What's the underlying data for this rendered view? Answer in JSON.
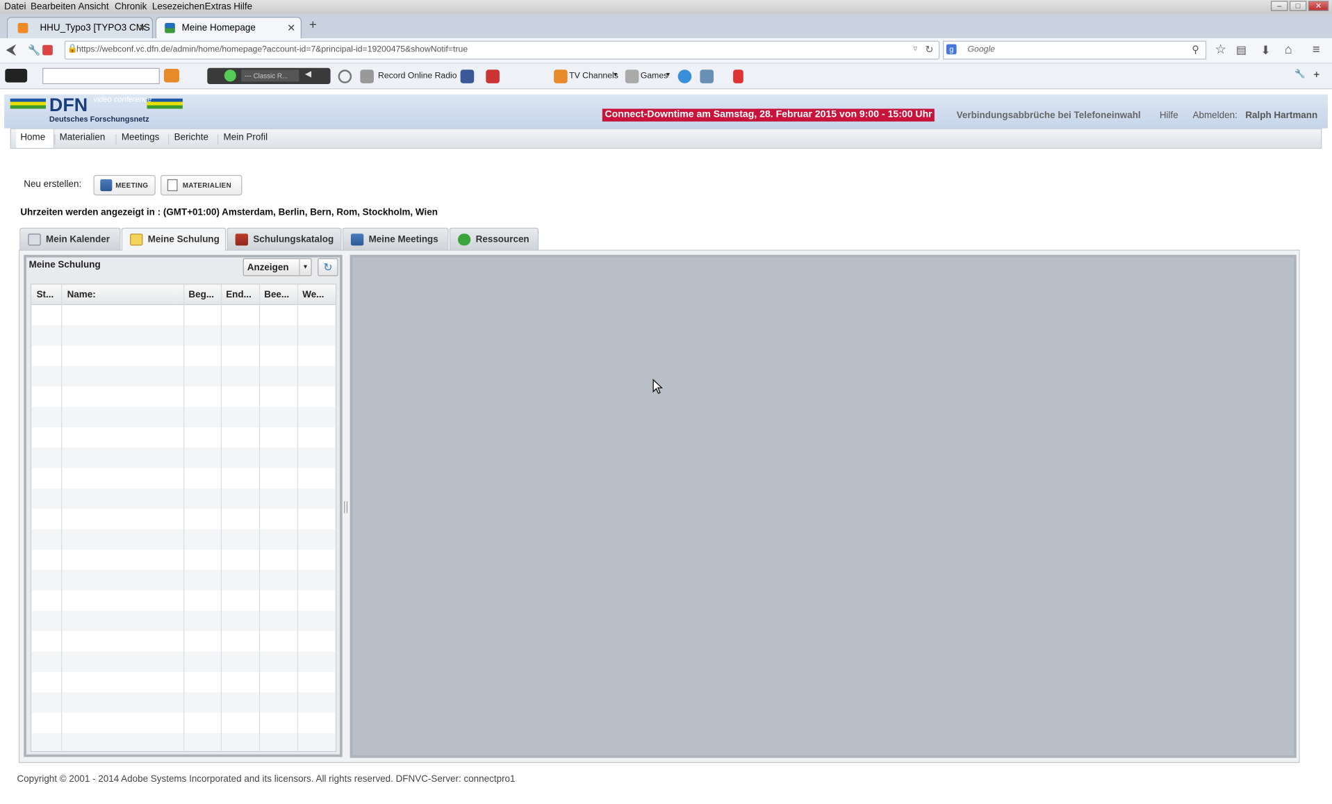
{
  "menubar": {
    "items": [
      "Datei",
      "Bearbeiten",
      "Ansicht",
      "Chronik",
      "Lesezeichen",
      "Extras",
      "Hilfe"
    ]
  },
  "browser_tabs": [
    {
      "label": "HHU_Typo3 [TYPO3 CMS ...",
      "active": false
    },
    {
      "label": "Meine Homepage",
      "active": true
    }
  ],
  "address_bar": {
    "url": "https://webconf.vc.dfn.de/admin/home/homepage?account-id=7&principal-id=19200475&showNotif=true",
    "search_placeholder": "Google"
  },
  "toolbar": {
    "radio_station": "--- Classic R...",
    "record_label": "Record Online Radio",
    "tv_label": "TV Channels",
    "games_label": "Games"
  },
  "header": {
    "logo_title": "DFN",
    "logo_badge": "video conference",
    "logo_subtitle": "Deutsches Forschungsnetz",
    "alert": "Connect-Downtime am Samstag, 28. Februar 2015 von 9:00 - 15:00 Uhr",
    "dropout_link": "Verbindungsabbrüche bei Telefoneinwahl",
    "help_link": "Hilfe",
    "logout_label": "Abmelden:",
    "user_name": "Ralph Hartmann"
  },
  "app_nav": [
    "Home",
    "Materialien",
    "Meetings",
    "Berichte",
    "Mein Profil"
  ],
  "create": {
    "label": "Neu erstellen:",
    "meeting_button": "MEETING",
    "materials_button": "MATERIALIEN"
  },
  "timezone_text": "Uhrzeiten werden angezeigt in : (GMT+01:00) Amsterdam, Berlin, Bern, Rom, Stockholm, Wien",
  "main_tabs": [
    {
      "label": "Mein Kalender",
      "active": false
    },
    {
      "label": "Meine Schulung",
      "active": true
    },
    {
      "label": "Schulungskatalog",
      "active": false
    },
    {
      "label": "Meine Meetings",
      "active": false
    },
    {
      "label": "Ressourcen",
      "active": false
    }
  ],
  "panel": {
    "title": "Meine Schulung",
    "view_select": "Anzeigen",
    "columns": [
      "St...",
      "Name:",
      "Beg...",
      "End...",
      "Bee...",
      "We..."
    ]
  },
  "footer": "Copyright © 2001 - 2014 Adobe Systems Incorporated and its licensors. All rights reserved.  DFNVC-Server: connectpro1",
  "colors": {
    "alert_bg": "#c8143a",
    "header_bg": "#c6d5ea",
    "panel_bg": "#b9bfc6",
    "dfn_blue": "#1a3e7e"
  }
}
